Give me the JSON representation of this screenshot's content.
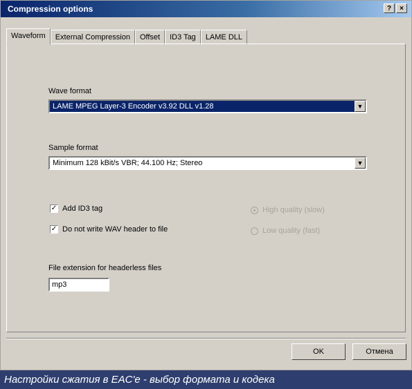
{
  "window": {
    "title": "Compression options",
    "help_btn": "?",
    "close_btn": "×"
  },
  "tabs": [
    {
      "label": "Waveform",
      "active": true
    },
    {
      "label": "External Compression",
      "active": false
    },
    {
      "label": "Offset",
      "active": false
    },
    {
      "label": "ID3 Tag",
      "active": false
    },
    {
      "label": "LAME DLL",
      "active": false
    }
  ],
  "wave_format": {
    "label": "Wave format",
    "value": "LAME MPEG Layer-3 Encoder v3.92 DLL v1.28"
  },
  "sample_format": {
    "label": "Sample format",
    "value": "Minimum 128 kBit/s VBR; 44.100 Hz; Stereo"
  },
  "checkboxes": [
    {
      "label": "Add ID3 tag",
      "checked": true
    },
    {
      "label": "Do not write WAV header to file",
      "checked": true
    }
  ],
  "radios": [
    {
      "label": "High quality (slow)",
      "selected": true
    },
    {
      "label": "Low quality (fast)",
      "selected": false
    }
  ],
  "extension": {
    "label": "File extension for headerless files",
    "value": "mp3"
  },
  "buttons": {
    "ok": "OK",
    "cancel": "Отмена"
  },
  "caption": "Настройки сжатия в EAC'е - выбор формата и кодека",
  "colors": {
    "dialog_bg": "#d4d0c8",
    "titlebar": "#0a246a",
    "selection": "#0a246a",
    "caption_bg": "#2e3e6e"
  }
}
